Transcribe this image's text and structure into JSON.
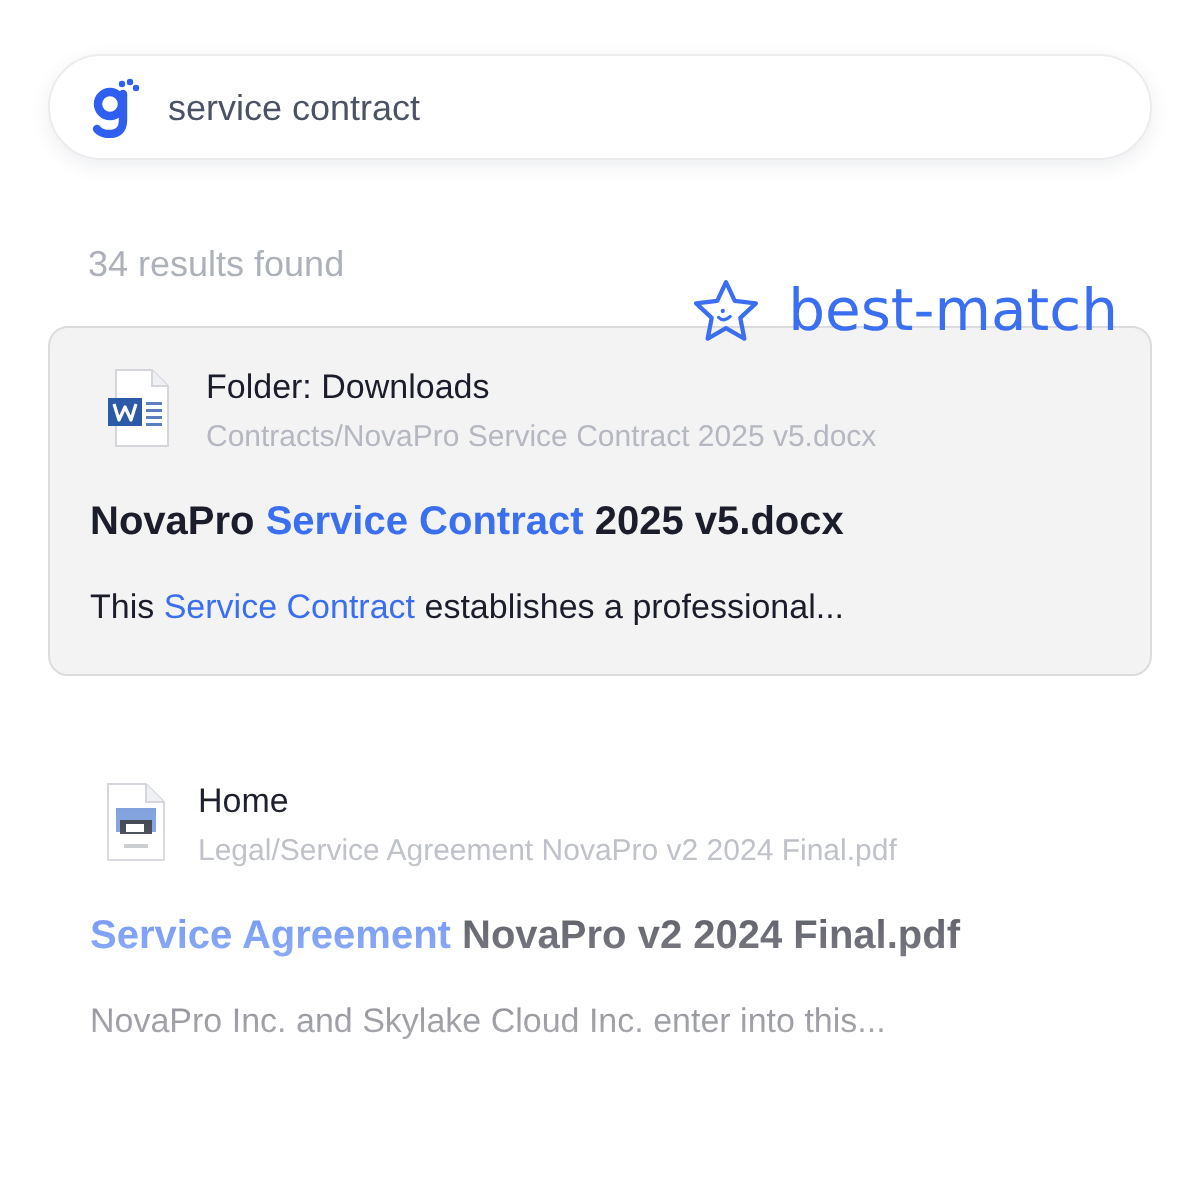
{
  "search": {
    "value": "service contract"
  },
  "results_summary": "34 results found",
  "results": [
    {
      "selected": true,
      "badge": "best-match",
      "kind": "docx",
      "location": "Folder: Downloads",
      "path": "Contracts/NovaPro Service Contract 2025 v5.docx",
      "title": [
        {
          "text": "NovaPro ",
          "highlight": false
        },
        {
          "text": "Service Contract",
          "highlight": true
        },
        {
          "text": " 2025 v5.docx",
          "highlight": false
        }
      ],
      "snippet": [
        {
          "text": "This ",
          "highlight": false
        },
        {
          "text": "Service Contract",
          "highlight": true
        },
        {
          "text": " establishes a professional...",
          "highlight": false
        }
      ]
    },
    {
      "selected": false,
      "kind": "pdf",
      "location": "Home",
      "path": "Legal/Service Agreement NovaPro v2 2024 Final.pdf",
      "title": [
        {
          "text": "Service Agreement",
          "highlight": true
        },
        {
          "text": " NovaPro v2 2024 Final.pdf",
          "highlight": false
        }
      ],
      "snippet": [
        {
          "text": "NovaPro Inc. and Skylake Cloud Inc. enter into this...",
          "highlight": false
        }
      ]
    }
  ]
}
